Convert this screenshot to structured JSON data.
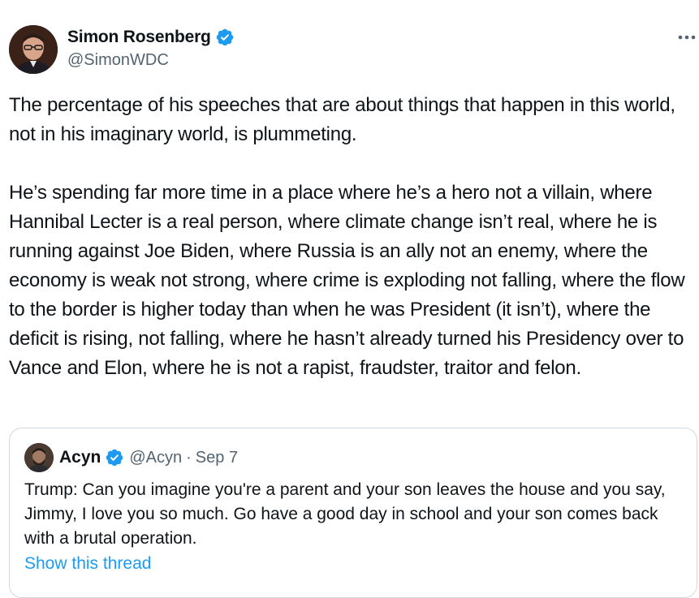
{
  "author": {
    "name": "Simon Rosenberg",
    "handle": "@SimonWDC",
    "verified_color": "#1d9bf0"
  },
  "tweet": {
    "text": "The percentage of his speeches that are about things that happen in this world, not in his imaginary world, is plummeting.\n\nHe’s spending far more time in a place where he’s a hero not a villain, where Hannibal Lecter is a real person, where climate change isn’t real, where he is running against Joe Biden, where Russia is an ally not an enemy, where the economy is weak not strong, where crime is exploding not falling, where the flow to the border is higher today than when he was President (it isn’t), where the deficit is rising, not falling, where he hasn’t already turned his Presidency over to Vance and Elon, where he is not a rapist, fraudster, traitor and felon."
  },
  "quote": {
    "name": "Acyn",
    "handle": "@Acyn",
    "separator": "·",
    "date": "Sep 7",
    "text": "Trump: Can you imagine you're a parent and your son leaves the house and you say, Jimmy, I love you so much. Go have a good day in school and your son comes back with a brutal operation.",
    "show_thread_label": "Show this thread"
  },
  "icons": {
    "more": "more-horizontal-icon",
    "verified": "verified-badge-icon"
  },
  "colors": {
    "text": "#0f1419",
    "secondary": "#536471",
    "link": "#1d9bf0",
    "border": "#cfd9de"
  }
}
